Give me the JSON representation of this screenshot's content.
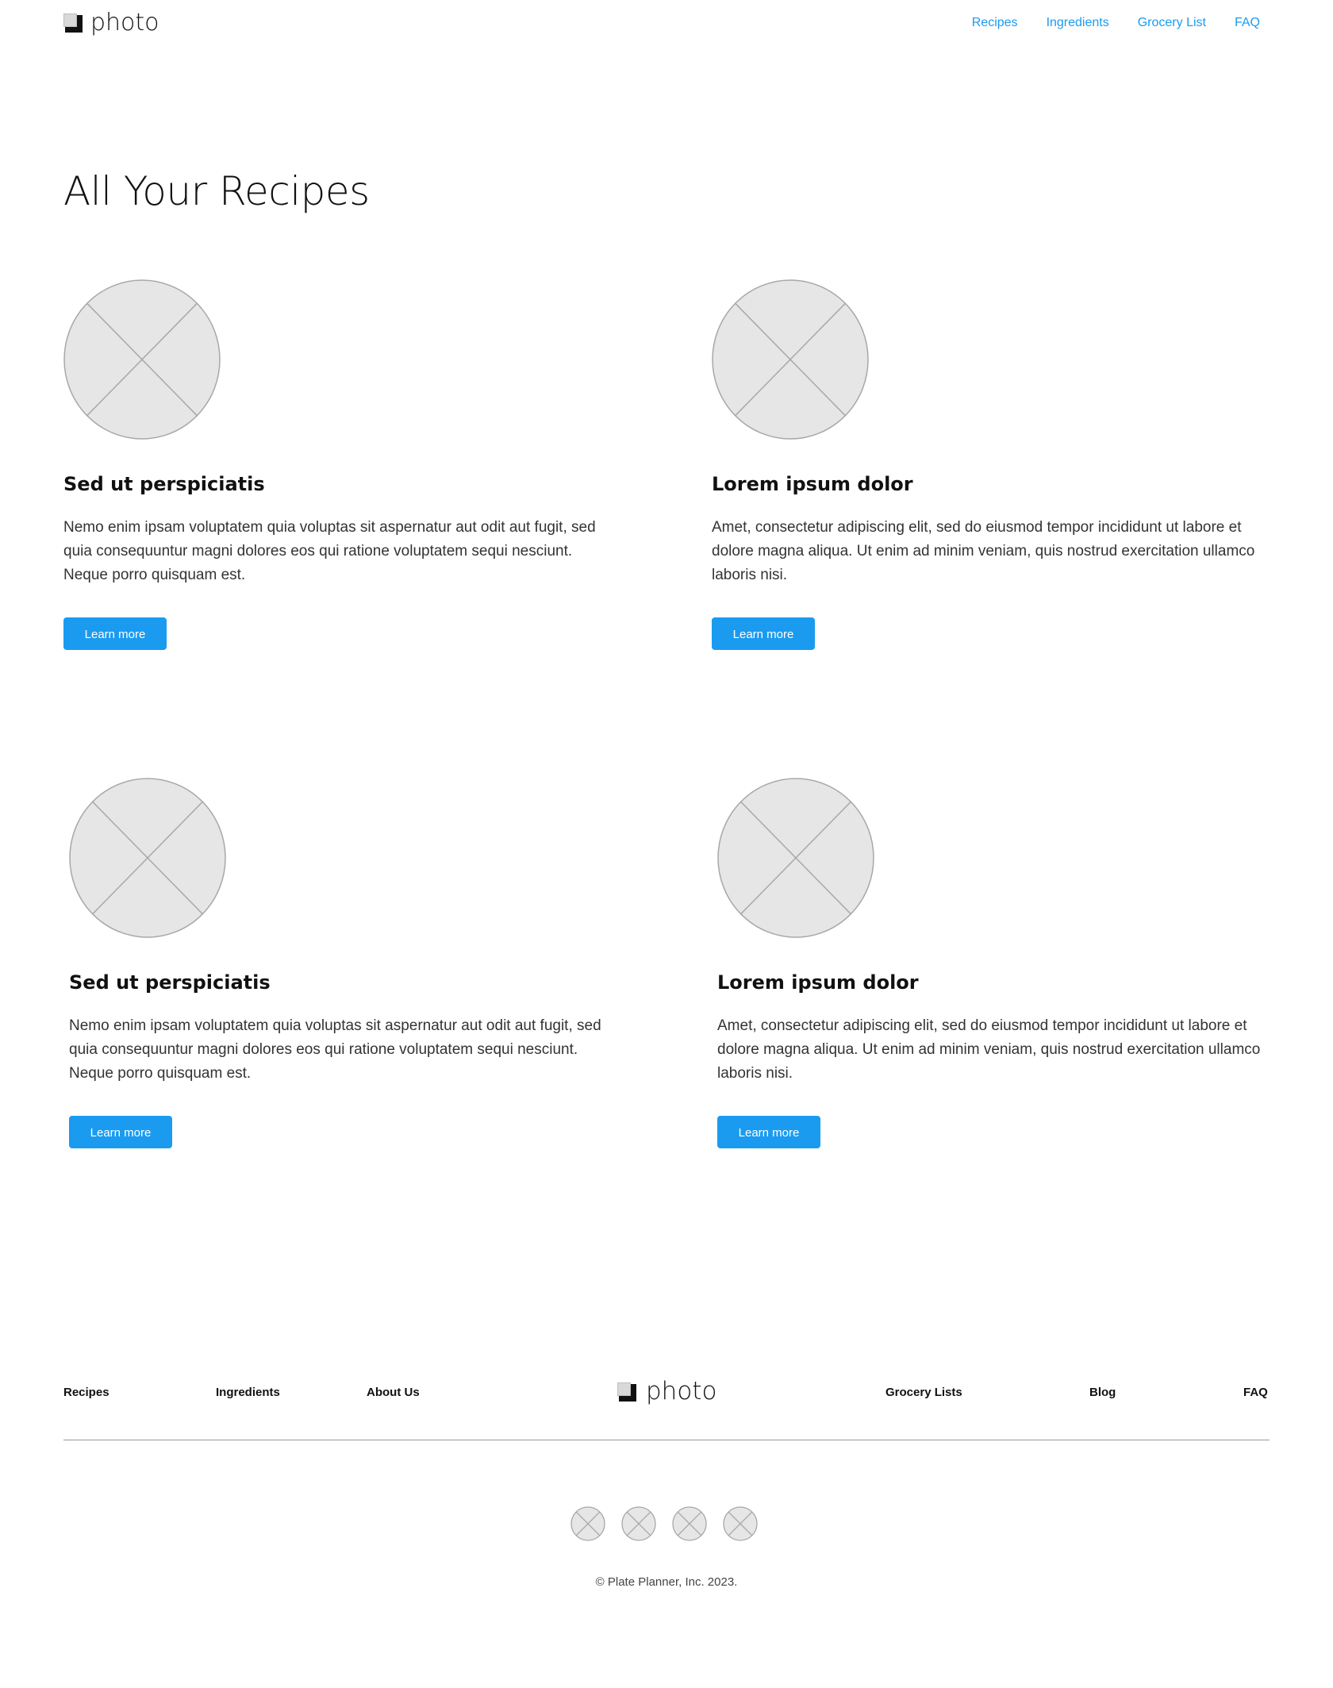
{
  "header": {
    "logo_text": "photo",
    "nav": [
      "Recipes",
      "Ingredients",
      "Grocery List",
      "FAQ"
    ]
  },
  "page_title": "All Your Recipes",
  "cards": [
    {
      "title": "Sed ut perspiciatis",
      "description": "Nemo enim ipsam voluptatem quia voluptas sit aspernatur aut odit aut fugit, sed quia consequuntur magni dolores eos qui ratione voluptatem sequi nesciunt. Neque porro quisquam est.",
      "button": "Learn more",
      "image_icon": "image-placeholder-icon"
    },
    {
      "title": "Lorem ipsum dolor",
      "description": "Amet, consectetur adipiscing elit, sed do eiusmod tempor incididunt ut labore et dolore magna aliqua. Ut enim ad minim veniam, quis nostrud exercitation ullamco laboris nisi.",
      "button": "Learn more",
      "image_icon": "image-placeholder-icon"
    },
    {
      "title": "Sed ut perspiciatis",
      "description": "Nemo enim ipsam voluptatem quia voluptas sit aspernatur aut odit aut fugit, sed quia consequuntur magni dolores eos qui ratione voluptatem sequi nesciunt. Neque porro quisquam est.",
      "button": "Learn more",
      "image_icon": "image-placeholder-icon"
    },
    {
      "title": "Lorem ipsum dolor",
      "description": "Amet, consectetur adipiscing elit, sed do eiusmod tempor incididunt ut labore et dolore magna aliqua. Ut enim ad minim veniam, quis nostrud exercitation ullamco laboris nisi.",
      "button": "Learn more",
      "image_icon": "image-placeholder-icon"
    }
  ],
  "footer": {
    "links_left": [
      "Recipes",
      "Ingredients",
      "About Us"
    ],
    "logo_text": "photo",
    "links_right": [
      "Grocery Lists",
      "Blog",
      "FAQ"
    ],
    "social_icons": [
      "social-placeholder-icon",
      "social-placeholder-icon",
      "social-placeholder-icon",
      "social-placeholder-icon"
    ],
    "copyright": "© Plate Planner, Inc. 2023."
  },
  "colors": {
    "accent": "#1a9bf0",
    "placeholder_fill": "#e6e6e6",
    "placeholder_stroke": "#a8a8a8"
  }
}
